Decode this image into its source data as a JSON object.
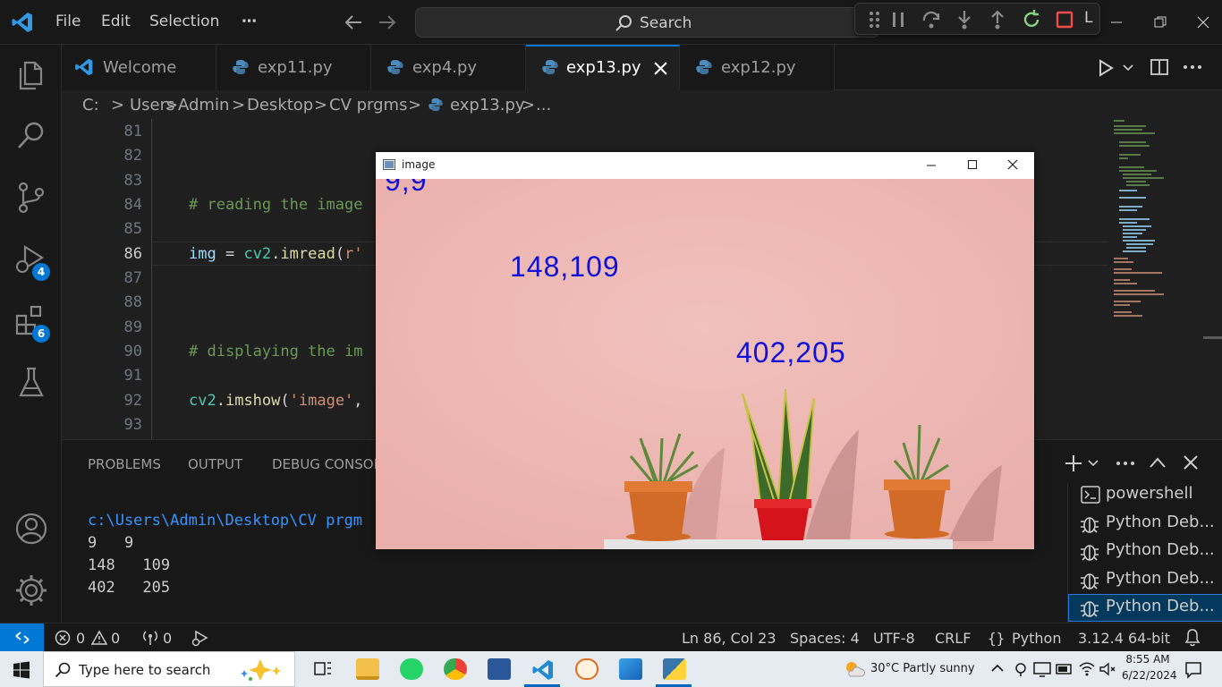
{
  "menubar": {
    "file": "File",
    "edit": "Edit",
    "selection": "Selection",
    "more": "⋯"
  },
  "search": {
    "label": "Search"
  },
  "debug_toolbar": {
    "profile_letter": "L"
  },
  "activity_badges": {
    "run_debug": "4",
    "extensions": "6"
  },
  "tabs": [
    {
      "label": "Welcome"
    },
    {
      "label": "exp11.py"
    },
    {
      "label": "exp4.py"
    },
    {
      "label": "exp13.py"
    },
    {
      "label": "exp12.py"
    }
  ],
  "breadcrumb": {
    "drive": "C:",
    "sep": ">",
    "users": "Users",
    "admin": "Admin",
    "desktop": "Desktop",
    "folder": "CV prgms",
    "file": "exp13.py",
    "ellipsis": "..."
  },
  "editor": {
    "line_numbers": [
      "81",
      "82",
      "83",
      "84",
      "85",
      "86",
      "87",
      "88",
      "89",
      "90",
      "91",
      "92",
      "93"
    ],
    "current_line": "86",
    "line84": "# reading the image",
    "line86": {
      "var": "img",
      "eq": " = ",
      "mod": "cv2",
      "dot": ".",
      "fn": "imread",
      "paren": "(",
      "str": "r'"
    },
    "line90": "# displaying the im",
    "line92": {
      "mod": "cv2",
      "dot": ".",
      "fn": "imshow",
      "paren": "(",
      "str": "'image'",
      "comma": ","
    }
  },
  "panel": {
    "tabs": {
      "problems": "PROBLEMS",
      "output": "OUTPUT",
      "debug_console": "DEBUG CONSOL"
    },
    "terminal_lines": [
      "c:\\Users\\Admin\\Desktop\\CV prgm",
      "9   9",
      "148   109",
      "402   205"
    ],
    "terminals": [
      "powershell",
      "Python Deb...",
      "Python Deb...",
      "Python Deb...",
      "Python Deb..."
    ]
  },
  "statusbar": {
    "errors": "0",
    "warnings": "0",
    "ports": "0",
    "position": "Ln 86, Col 23",
    "spaces": "Spaces: 4",
    "encoding": "UTF-8",
    "eol": "CRLF",
    "language": "Python",
    "interpreter": "3.12.4 64-bit"
  },
  "taskbar": {
    "search_placeholder": "Type here to search",
    "weather": "30°C  Partly sunny",
    "time": "8:55 AM",
    "date": "6/22/2024"
  },
  "image_window": {
    "title": "image",
    "labels": [
      "9,9",
      "148,109",
      "402,205"
    ]
  },
  "colors": {
    "accent": "#0078d4",
    "coord_text": "#1010d8",
    "wall_pink": "#efb9b5"
  }
}
